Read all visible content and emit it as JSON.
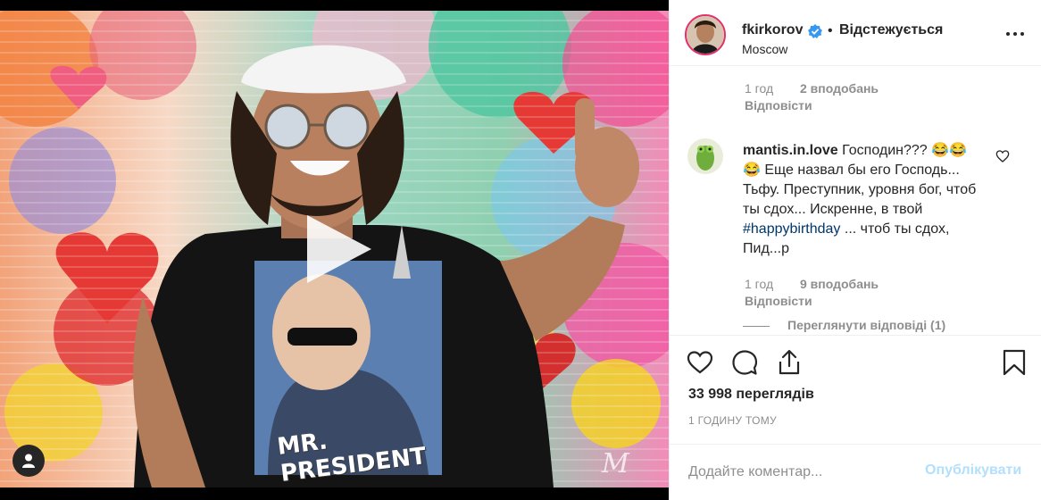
{
  "post": {
    "username": "fkirkorov",
    "separator": "•",
    "follow_status": "Відстежується",
    "location": "Moscow"
  },
  "comments": {
    "previous": {
      "age": "1 год",
      "likes": "2 вподобань",
      "reply": "Відповісти"
    },
    "main": {
      "username": "mantis.in.love",
      "text_part1": "Господин??? 😂😂😂 Еще назвал бы его Господь... Тьфу. Преступник, уровня бог, чтоб ты сдох... Искренне, в твой ",
      "hashtag": "#happybirthday",
      "text_part2": " ... чтоб ты сдох, Пид...р",
      "age": "1 год",
      "likes": "9 вподобань",
      "reply": "Відповісти",
      "view_replies": "Переглянути відповіді (1)"
    }
  },
  "stats": {
    "views": "33 998 переглядів",
    "time_ago": "1 ГОДИНУ ТОМУ"
  },
  "composer": {
    "placeholder": "Додайте коментар...",
    "post_label": "Опублікувати"
  },
  "media": {
    "shirt_text_line1": "MR.",
    "shirt_text_line2": "PRESIDENT",
    "watermark": "M"
  },
  "icons": {
    "verified": "verified-badge-icon",
    "more": "more-options-icon",
    "like": "heart-icon",
    "comment": "comment-bubble-icon",
    "share": "share-icon",
    "save": "bookmark-icon",
    "play": "play-icon",
    "user_tag": "user-tag-icon"
  },
  "colors": {
    "verified_blue": "#3897f0",
    "link_blue": "#00376b",
    "post_button_disabled": "#b2dffc",
    "muted": "#8e8e8e"
  }
}
